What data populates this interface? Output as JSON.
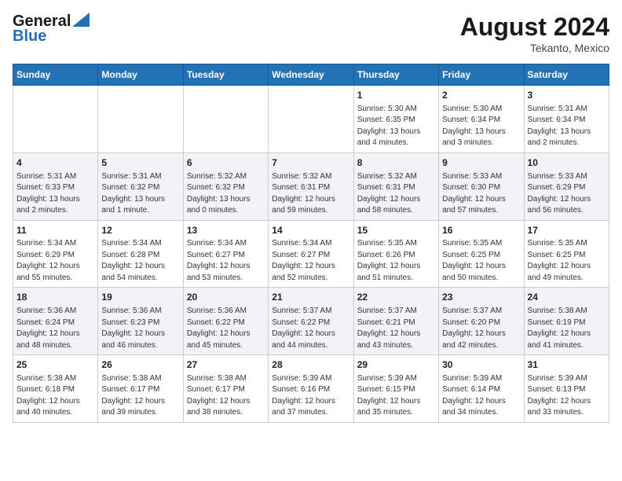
{
  "header": {
    "logo_line1": "General",
    "logo_line2": "Blue",
    "main_title": "August 2024",
    "subtitle": "Tekanto, Mexico"
  },
  "days_of_week": [
    "Sunday",
    "Monday",
    "Tuesday",
    "Wednesday",
    "Thursday",
    "Friday",
    "Saturday"
  ],
  "weeks": [
    [
      {
        "day": "",
        "content": ""
      },
      {
        "day": "",
        "content": ""
      },
      {
        "day": "",
        "content": ""
      },
      {
        "day": "",
        "content": ""
      },
      {
        "day": "1",
        "content": "Sunrise: 5:30 AM\nSunset: 6:35 PM\nDaylight: 13 hours\nand 4 minutes."
      },
      {
        "day": "2",
        "content": "Sunrise: 5:30 AM\nSunset: 6:34 PM\nDaylight: 13 hours\nand 3 minutes."
      },
      {
        "day": "3",
        "content": "Sunrise: 5:31 AM\nSunset: 6:34 PM\nDaylight: 13 hours\nand 2 minutes."
      }
    ],
    [
      {
        "day": "4",
        "content": "Sunrise: 5:31 AM\nSunset: 6:33 PM\nDaylight: 13 hours\nand 2 minutes."
      },
      {
        "day": "5",
        "content": "Sunrise: 5:31 AM\nSunset: 6:32 PM\nDaylight: 13 hours\nand 1 minute."
      },
      {
        "day": "6",
        "content": "Sunrise: 5:32 AM\nSunset: 6:32 PM\nDaylight: 13 hours\nand 0 minutes."
      },
      {
        "day": "7",
        "content": "Sunrise: 5:32 AM\nSunset: 6:31 PM\nDaylight: 12 hours\nand 59 minutes."
      },
      {
        "day": "8",
        "content": "Sunrise: 5:32 AM\nSunset: 6:31 PM\nDaylight: 12 hours\nand 58 minutes."
      },
      {
        "day": "9",
        "content": "Sunrise: 5:33 AM\nSunset: 6:30 PM\nDaylight: 12 hours\nand 57 minutes."
      },
      {
        "day": "10",
        "content": "Sunrise: 5:33 AM\nSunset: 6:29 PM\nDaylight: 12 hours\nand 56 minutes."
      }
    ],
    [
      {
        "day": "11",
        "content": "Sunrise: 5:34 AM\nSunset: 6:29 PM\nDaylight: 12 hours\nand 55 minutes."
      },
      {
        "day": "12",
        "content": "Sunrise: 5:34 AM\nSunset: 6:28 PM\nDaylight: 12 hours\nand 54 minutes."
      },
      {
        "day": "13",
        "content": "Sunrise: 5:34 AM\nSunset: 6:27 PM\nDaylight: 12 hours\nand 53 minutes."
      },
      {
        "day": "14",
        "content": "Sunrise: 5:34 AM\nSunset: 6:27 PM\nDaylight: 12 hours\nand 52 minutes."
      },
      {
        "day": "15",
        "content": "Sunrise: 5:35 AM\nSunset: 6:26 PM\nDaylight: 12 hours\nand 51 minutes."
      },
      {
        "day": "16",
        "content": "Sunrise: 5:35 AM\nSunset: 6:25 PM\nDaylight: 12 hours\nand 50 minutes."
      },
      {
        "day": "17",
        "content": "Sunrise: 5:35 AM\nSunset: 6:25 PM\nDaylight: 12 hours\nand 49 minutes."
      }
    ],
    [
      {
        "day": "18",
        "content": "Sunrise: 5:36 AM\nSunset: 6:24 PM\nDaylight: 12 hours\nand 48 minutes."
      },
      {
        "day": "19",
        "content": "Sunrise: 5:36 AM\nSunset: 6:23 PM\nDaylight: 12 hours\nand 46 minutes."
      },
      {
        "day": "20",
        "content": "Sunrise: 5:36 AM\nSunset: 6:22 PM\nDaylight: 12 hours\nand 45 minutes."
      },
      {
        "day": "21",
        "content": "Sunrise: 5:37 AM\nSunset: 6:22 PM\nDaylight: 12 hours\nand 44 minutes."
      },
      {
        "day": "22",
        "content": "Sunrise: 5:37 AM\nSunset: 6:21 PM\nDaylight: 12 hours\nand 43 minutes."
      },
      {
        "day": "23",
        "content": "Sunrise: 5:37 AM\nSunset: 6:20 PM\nDaylight: 12 hours\nand 42 minutes."
      },
      {
        "day": "24",
        "content": "Sunrise: 5:38 AM\nSunset: 6:19 PM\nDaylight: 12 hours\nand 41 minutes."
      }
    ],
    [
      {
        "day": "25",
        "content": "Sunrise: 5:38 AM\nSunset: 6:18 PM\nDaylight: 12 hours\nand 40 minutes."
      },
      {
        "day": "26",
        "content": "Sunrise: 5:38 AM\nSunset: 6:17 PM\nDaylight: 12 hours\nand 39 minutes."
      },
      {
        "day": "27",
        "content": "Sunrise: 5:38 AM\nSunset: 6:17 PM\nDaylight: 12 hours\nand 38 minutes."
      },
      {
        "day": "28",
        "content": "Sunrise: 5:39 AM\nSunset: 6:16 PM\nDaylight: 12 hours\nand 37 minutes."
      },
      {
        "day": "29",
        "content": "Sunrise: 5:39 AM\nSunset: 6:15 PM\nDaylight: 12 hours\nand 35 minutes."
      },
      {
        "day": "30",
        "content": "Sunrise: 5:39 AM\nSunset: 6:14 PM\nDaylight: 12 hours\nand 34 minutes."
      },
      {
        "day": "31",
        "content": "Sunrise: 5:39 AM\nSunset: 6:13 PM\nDaylight: 12 hours\nand 33 minutes."
      }
    ]
  ]
}
